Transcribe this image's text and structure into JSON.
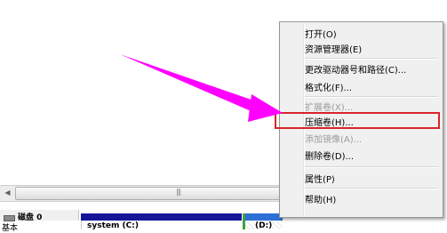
{
  "colors": {
    "arrow": "#ff00ff",
    "highlight_box": "#d8252b",
    "volume_c_bar": "#16159a",
    "volume_d_bar": "#2c6fd6",
    "volume_d_border": "#3aa43a"
  },
  "scrollbar": {
    "left_button_icon": "triangle-left-icon",
    "grip": "|||"
  },
  "disk": {
    "icon": "disk-drive-icon",
    "name": "磁盘 0",
    "type": "基本"
  },
  "volumes": [
    {
      "name": "system  (C:)"
    },
    {
      "name": "(D:)"
    }
  ],
  "context_menu": {
    "items": [
      {
        "label": "打开(O)",
        "enabled": true
      },
      {
        "label": "资源管理器(E)",
        "enabled": true
      },
      {
        "label": "更改驱动器号和路径(C)...",
        "enabled": true
      },
      {
        "label": "格式化(F)...",
        "enabled": true
      },
      {
        "label": "扩展卷(X)...",
        "enabled": false
      },
      {
        "label": "压缩卷(H)...",
        "enabled": true,
        "highlighted": true
      },
      {
        "label": "添加镜像(A)...",
        "enabled": false
      },
      {
        "label": "删除卷(D)...",
        "enabled": true
      },
      {
        "label": "属性(P)",
        "enabled": true
      },
      {
        "label": "帮助(H)",
        "enabled": true
      }
    ]
  },
  "annotation": {
    "type": "arrow",
    "points_to": "压缩卷(H)..."
  }
}
